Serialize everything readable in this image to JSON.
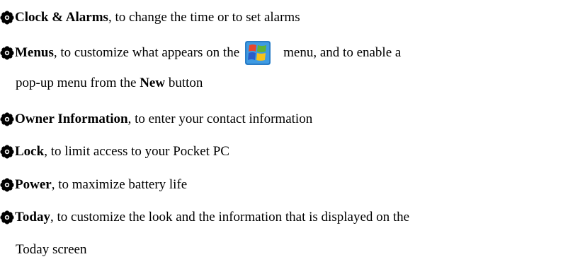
{
  "items": [
    {
      "term": "Clock & Alarms",
      "text": ", to change the time or to set alarms"
    },
    {
      "term": "Menus",
      "text_before_icon": ", to customize what appears on the",
      "icon": "windows-start-icon",
      "text_after_icon": "menu, and to enable a",
      "continuation_before": "pop-up menu from the ",
      "continuation_bold": "New",
      "continuation_after": " button"
    },
    {
      "term": "Owner Information",
      "text": ", to enter your contact information"
    },
    {
      "term": "Lock",
      "text": ", to limit access to your Pocket PC"
    },
    {
      "term": "Power",
      "text": ", to maximize battery life"
    },
    {
      "term": "Today",
      "text": ", to customize the look and the information that is displayed on the",
      "continuation": "Today screen"
    }
  ],
  "bullet_icon": "flower-bullet-icon",
  "colors": {
    "text": "#000000",
    "logo_red": "#e8452c",
    "logo_green": "#5fb336",
    "logo_blue": "#2a78c8",
    "logo_yellow": "#f6c21a",
    "logo_bg": "#2f8fd8"
  }
}
